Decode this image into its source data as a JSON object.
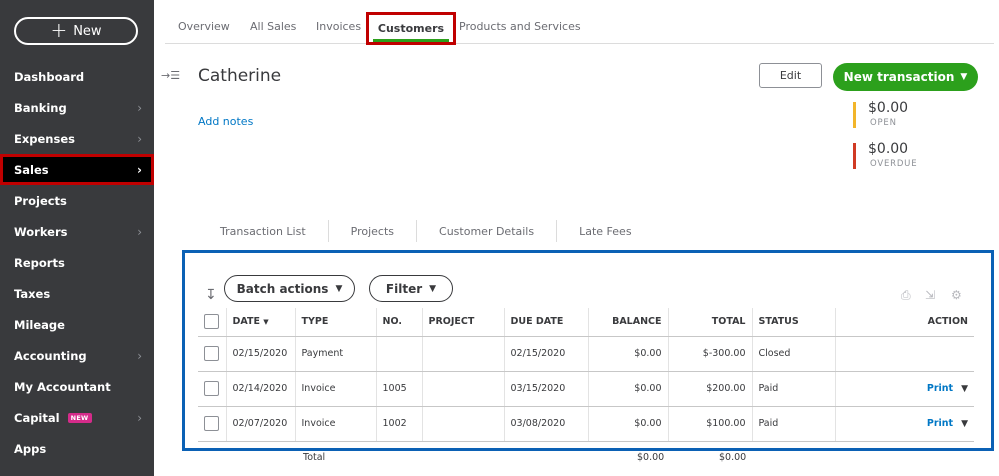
{
  "sidebar": {
    "new_label": "New",
    "items": [
      {
        "label": "Dashboard",
        "chevron": false
      },
      {
        "label": "Banking",
        "chevron": true
      },
      {
        "label": "Expenses",
        "chevron": true
      },
      {
        "label": "Sales",
        "chevron": true,
        "active": true
      },
      {
        "label": "Projects",
        "chevron": false
      },
      {
        "label": "Workers",
        "chevron": true
      },
      {
        "label": "Reports",
        "chevron": false
      },
      {
        "label": "Taxes",
        "chevron": false
      },
      {
        "label": "Mileage",
        "chevron": false
      },
      {
        "label": "Accounting",
        "chevron": true
      },
      {
        "label": "My Accountant",
        "chevron": false
      },
      {
        "label": "Capital",
        "chevron": true,
        "badge": "NEW"
      },
      {
        "label": "Apps",
        "chevron": false
      }
    ]
  },
  "tabs": {
    "overview": "Overview",
    "all_sales": "All Sales",
    "invoices": "Invoices",
    "customers": "Customers",
    "products": "Products and Services"
  },
  "customer": {
    "name": "Catherine",
    "add_notes": "Add notes"
  },
  "actions": {
    "edit": "Edit",
    "new_transaction": "New transaction"
  },
  "summary": {
    "open_amount": "$0.00",
    "open_label": "OPEN",
    "overdue_amount": "$0.00",
    "overdue_label": "OVERDUE"
  },
  "subtabs": [
    "Transaction List",
    "Projects",
    "Customer Details",
    "Late Fees"
  ],
  "toolbar": {
    "batch_actions": "Batch actions",
    "filter": "Filter"
  },
  "table": {
    "headers": {
      "date": "DATE",
      "type": "TYPE",
      "no": "NO.",
      "project": "PROJECT",
      "due_date": "DUE DATE",
      "balance": "BALANCE",
      "total": "TOTAL",
      "status": "STATUS",
      "action": "ACTION"
    },
    "rows": [
      {
        "date": "02/15/2020",
        "type": "Payment",
        "no": "",
        "project": "",
        "due_date": "02/15/2020",
        "balance": "$0.00",
        "total": "$-300.00",
        "status": "Closed",
        "action": ""
      },
      {
        "date": "02/14/2020",
        "type": "Invoice",
        "no": "1005",
        "project": "",
        "due_date": "03/15/2020",
        "balance": "$0.00",
        "total": "$200.00",
        "status": "Paid",
        "action": "Print"
      },
      {
        "date": "02/07/2020",
        "type": "Invoice",
        "no": "1002",
        "project": "",
        "due_date": "03/08/2020",
        "balance": "$0.00",
        "total": "$100.00",
        "status": "Paid",
        "action": "Print"
      }
    ],
    "footer": {
      "label": "Total",
      "balance": "$0.00",
      "total": "$0.00"
    }
  },
  "colors": {
    "sidebar_bg": "#393a3d",
    "brand_green": "#2ca01c",
    "link_blue": "#0077c5",
    "highlight_red": "#c00000",
    "highlight_blue": "#0b61b5",
    "open_bar": "#f2b52a",
    "overdue_bar": "#d03a24"
  }
}
